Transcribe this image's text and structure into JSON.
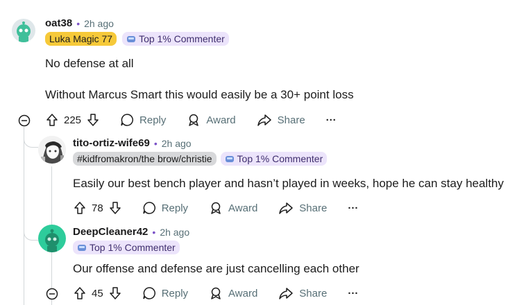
{
  "comments": [
    {
      "username": "oat38",
      "time": "2h ago",
      "flairs": [
        "Luka Magic 77",
        "Top 1% Commenter"
      ],
      "body": [
        "No defense at all",
        "Without Marcus Smart this would easily be a 30+ point loss"
      ],
      "votes": "225"
    },
    {
      "username": "tito-ortiz-wife69",
      "time": "2h ago",
      "flairs": [
        "#kidfromakron/the brow/christie",
        "Top 1% Commenter"
      ],
      "body": [
        "Easily our best bench player and hasn’t played in weeks, hope he can stay healthy"
      ],
      "votes": "78"
    },
    {
      "username": "DeepCleaner42",
      "time": "2h ago",
      "flairs": [
        "Top 1% Commenter"
      ],
      "body": [
        "Our offense and defense are just cancelling each other"
      ],
      "votes": "45"
    }
  ],
  "actions": {
    "reply": "Reply",
    "award": "Award",
    "share": "Share",
    "more": "···"
  },
  "colors": {
    "accent_dot": "#7b52c7",
    "flair_yellow": "#f6c939",
    "flair_purple_bg": "#ece4fb",
    "avatar_green": "#2ecc9b"
  }
}
